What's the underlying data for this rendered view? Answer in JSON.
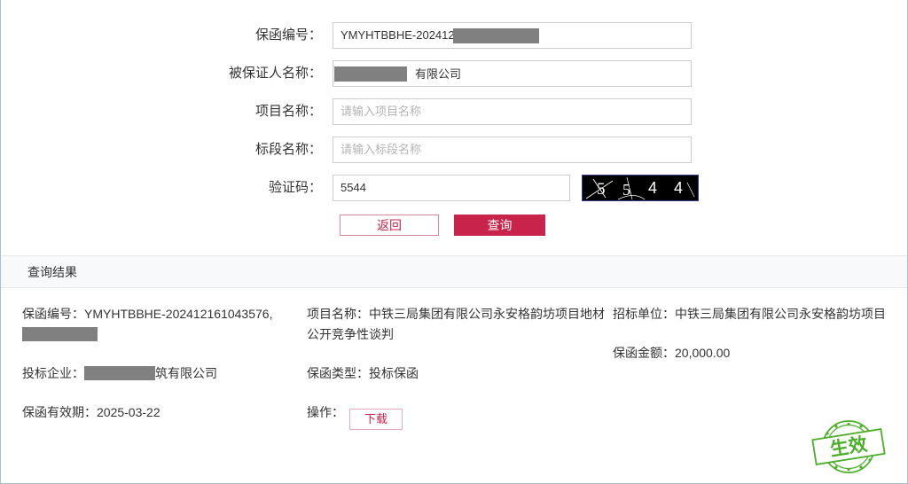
{
  "form": {
    "fields": [
      {
        "label": "保函编号：",
        "value": "YMYHTBBHE-20241216",
        "placeholder": "",
        "redacted": true
      },
      {
        "label": "被保证人名称：",
        "value": "有限公司",
        "placeholder": "",
        "redacted": true
      },
      {
        "label": "项目名称：",
        "value": "",
        "placeholder": "请输入项目名称",
        "redacted": false
      },
      {
        "label": "标段名称：",
        "value": "",
        "placeholder": "请输入标段名称",
        "redacted": false
      },
      {
        "label": "验证码：",
        "value": "5544",
        "placeholder": "",
        "redacted": false
      }
    ],
    "captcha": {
      "name": "captcha-image",
      "text": "5544",
      "digits": [
        "5",
        "5",
        "4",
        "4"
      ],
      "background": "#000000",
      "foreground": "#ffffff"
    },
    "buttons": {
      "back": "返回",
      "query": "查询"
    }
  },
  "results": {
    "header": "查询结果",
    "col1": {
      "guarantee_no_label": "保函编号：",
      "guarantee_no_value": "YMYHTBBHE-202412161043576,",
      "bidder_label": "投标企业：",
      "bidder_value": "筑有限公司",
      "validity_label": "保函有效期：",
      "validity_value": "2025-03-22"
    },
    "col2": {
      "project_label": "项目名称：",
      "project_value": "中铁三局集团有限公司永安格韵坊项目地材公开竞争性谈判",
      "type_label": "保函类型：",
      "type_value": "投标保函",
      "action_label": "操作：",
      "download_label": "下载"
    },
    "col3": {
      "tenderer_label": "招标单位：",
      "tenderer_value": "中铁三局集团有限公司永安格韵坊项目",
      "amount_label": "保函金额：",
      "amount_value": "20,000.00"
    }
  },
  "stamp": {
    "text": "生效",
    "color": "#4caf2a"
  },
  "colors": {
    "accent": "#c8234a",
    "border": "#a8c0d6",
    "redaction": "#808080",
    "stamp_green": "#4caf2a"
  }
}
